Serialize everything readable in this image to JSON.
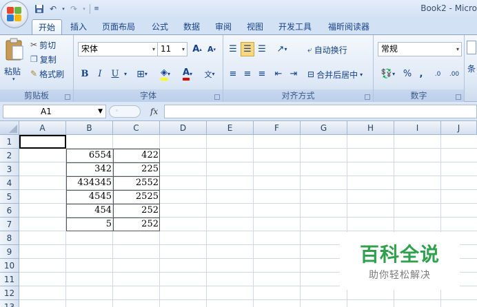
{
  "window": {
    "title": "Book2 - Micro"
  },
  "qat": {
    "undo": "↶",
    "redo": "↷"
  },
  "tabs": [
    "开始",
    "插入",
    "页面布局",
    "公式",
    "数据",
    "审阅",
    "视图",
    "开发工具",
    "福昕阅读器"
  ],
  "clipboard": {
    "paste": "粘贴",
    "cut": "剪切",
    "copy": "复制",
    "format_painter": "格式刷",
    "label": "剪贴板"
  },
  "font": {
    "name": "宋体",
    "size": "11",
    "bold": "B",
    "italic": "I",
    "underline": "U",
    "grow": "A",
    "shrink": "A",
    "label": "字体"
  },
  "alignment": {
    "wrap": "自动换行",
    "merge": "合并后居中",
    "label": "对齐方式"
  },
  "number": {
    "format": "常规",
    "percent": "%",
    "comma": ",",
    "inc_dec": ".0",
    "dec_dec": ".00",
    "label": "数字"
  },
  "styles": {
    "label": "条"
  },
  "formula_bar": {
    "name_box": "A1",
    "fx": "fx",
    "value": ""
  },
  "columns": [
    "A",
    "B",
    "C",
    "D",
    "E",
    "F",
    "G",
    "H",
    "I",
    "J"
  ],
  "rows": [
    "1",
    "2",
    "3",
    "4",
    "5",
    "6",
    "7",
    "8",
    "9",
    "10",
    "11",
    "12",
    "13"
  ],
  "table": [
    {
      "b": "6554",
      "c": "422"
    },
    {
      "b": "342",
      "c": "225"
    },
    {
      "b": "434345",
      "c": "2552"
    },
    {
      "b": "4545",
      "c": "2525"
    },
    {
      "b": "454",
      "c": "252"
    },
    {
      "b": "5",
      "c": "252"
    }
  ],
  "watermark": {
    "title": "百科全说",
    "subtitle": "助你轻松解决"
  },
  "colors": {
    "accent": "#15428b",
    "watermark_green": "#2fa04c"
  }
}
